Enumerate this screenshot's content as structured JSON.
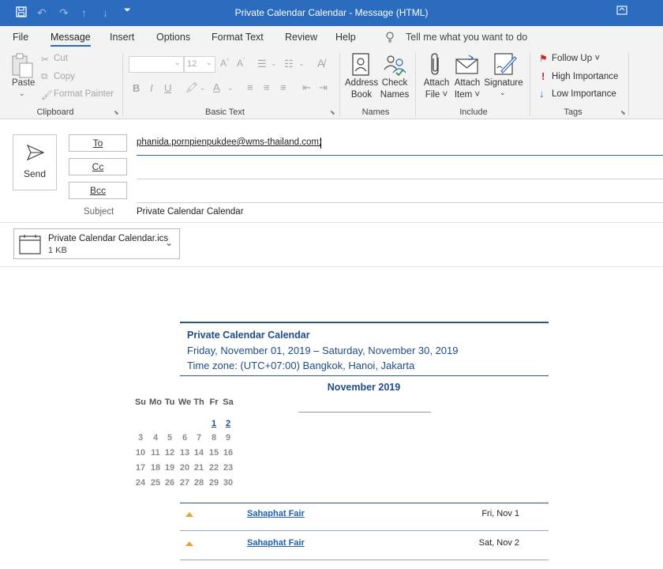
{
  "window": {
    "title": "Private Calendar Calendar  -  Message (HTML)"
  },
  "tabs": [
    "File",
    "Message",
    "Insert",
    "Options",
    "Format Text",
    "Review",
    "Help"
  ],
  "tell_me": "Tell me what you want to do",
  "clipboard": {
    "paste": "Paste",
    "cut": "Cut",
    "copy": "Copy",
    "format_painter": "Format Painter",
    "label": "Clipboard"
  },
  "basic_text": {
    "font_size": "12",
    "bold": "B",
    "italic": "I",
    "underline": "U",
    "label": "Basic Text"
  },
  "names": {
    "address_book_1": "Address",
    "address_book_2": "Book",
    "check_names_1": "Check",
    "check_names_2": "Names",
    "label": "Names"
  },
  "include": {
    "attach_file_1": "Attach",
    "attach_file_2": "File",
    "attach_item_1": "Attach",
    "attach_item_2": "Item",
    "signature": "Signature",
    "label": "Include"
  },
  "tags": {
    "follow_up": "Follow Up",
    "high_importance": "High Importance",
    "low_importance": "Low Importance",
    "label": "Tags"
  },
  "compose": {
    "send": "Send",
    "to_label": "To",
    "cc_label": "Cc",
    "bcc_label": "Bcc",
    "subject_label": "Subject",
    "to_value": "phanida.pornpienpukdee@wms-thailand.com;",
    "subject_value": "Private Calendar Calendar"
  },
  "attachment": {
    "name": "Private Calendar Calendar.ics",
    "size": "1 KB"
  },
  "calendar": {
    "title": "Private Calendar Calendar",
    "range": "Friday, November 01, 2019 – Saturday, November 30, 2019",
    "timezone": "Time zone: (UTC+07:00) Bangkok, Hanoi, Jakarta",
    "month": "November 2019",
    "weekdays": [
      "Su",
      "Mo",
      "Tu",
      "We",
      "Th",
      "Fr",
      "Sa"
    ],
    "weeks": [
      [
        "",
        "",
        "",
        "",
        "",
        "1",
        "2"
      ],
      [
        "3",
        "4",
        "5",
        "6",
        "7",
        "8",
        "9"
      ],
      [
        "10",
        "11",
        "12",
        "13",
        "14",
        "15",
        "16"
      ],
      [
        "17",
        "18",
        "19",
        "20",
        "21",
        "22",
        "23"
      ],
      [
        "24",
        "25",
        "26",
        "27",
        "28",
        "29",
        "30"
      ]
    ],
    "events": [
      {
        "name": "Sahaphat Fair",
        "date": "Fri, Nov 1"
      },
      {
        "name": "Sahaphat Fair",
        "date": "Sat, Nov 2"
      }
    ]
  },
  "colors": {
    "accent": "#2b6cbf",
    "calendar_blue": "#1f4d8a",
    "follow_up_red": "#c42b1c",
    "event_arrow": "#e8a33c"
  }
}
